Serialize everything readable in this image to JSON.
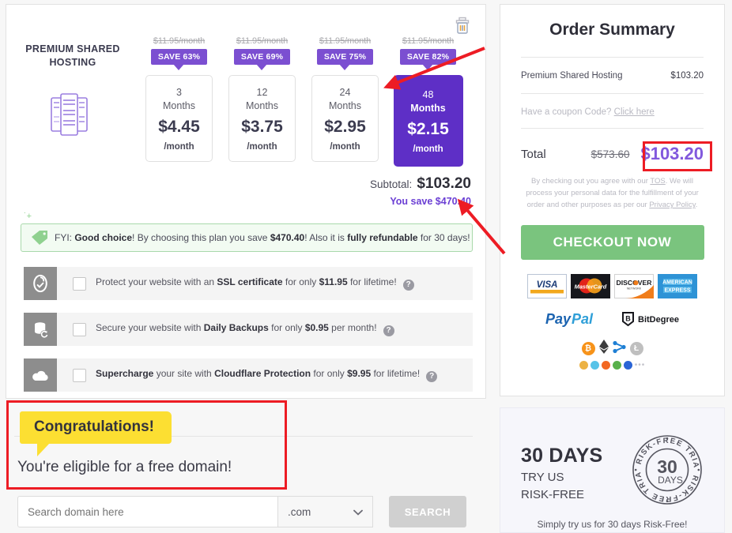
{
  "left": {
    "plan_name": "PREMIUM SHARED HOSTING",
    "plan_icon": "server-rack-icon",
    "delete_icon": "trash-icon",
    "terms": [
      {
        "old_price": "$11.95/month",
        "save_badge": "SAVE 63%",
        "months_num": "3",
        "months_label": "Months",
        "amount": "$4.45",
        "per": "/month",
        "selected": false
      },
      {
        "old_price": "$11.95/month",
        "save_badge": "SAVE 69%",
        "months_num": "12",
        "months_label": "Months",
        "amount": "$3.75",
        "per": "/month",
        "selected": false
      },
      {
        "old_price": "$11.95/month",
        "save_badge": "SAVE 75%",
        "months_num": "24",
        "months_label": "Months",
        "amount": "$2.95",
        "per": "/month",
        "selected": false
      },
      {
        "old_price": "$11.95/month",
        "save_badge": "SAVE 82%",
        "months_num": "48",
        "months_label": "Months",
        "amount": "$2.15",
        "per": "/month",
        "selected": true
      }
    ],
    "subtotal_label": "Subtotal:",
    "subtotal_value": "$103.20",
    "you_save": "You save $470.40",
    "fyi": {
      "icon": "price-tag-icon",
      "prefix": "FYI: ",
      "bold1": "Good choice",
      "mid1": "! By choosing this plan you save ",
      "bold2": "$470.40",
      "mid2": "! Also it is ",
      "bold3": "fully refundable",
      "suffix": " for 30 days!"
    },
    "addons": [
      {
        "icon": "ssl-lock-shield-icon",
        "pre": "Protect your website with an ",
        "bold1": "SSL certificate",
        "mid": " for only ",
        "bold2": "$11.95",
        "post": " for lifetime!",
        "checked": false
      },
      {
        "icon": "database-backup-icon",
        "pre": "Secure your website with ",
        "bold1": "Daily Backups",
        "mid": " for only ",
        "bold2": "$0.95",
        "post": " per month!",
        "checked": false
      },
      {
        "icon": "cloudflare-cloud-icon",
        "pre": "",
        "bold1": "Supercharge",
        "mid": " your site with ",
        "bold2": "Cloudflare Protection",
        "post": " for only $9.95 for lifetime!",
        "checked": false
      }
    ],
    "addon3_extra": {
      "bold_price": "$9.95"
    },
    "congrats_bubble": "Congratulations!",
    "eligible_text": "You're eligible for a free domain!",
    "domain_placeholder": "Search domain here",
    "domain_value": "",
    "tld_selected": ".com",
    "tld_chevron": "chevron-down-icon",
    "search_button": "SEARCH",
    "help_icon": "question-mark-icon"
  },
  "summary": {
    "title": "Order Summary",
    "item_label": "Premium Shared Hosting",
    "item_value": "$103.20",
    "coupon_text": "Have a coupon Code? ",
    "coupon_link": "Click here",
    "total_label": "Total",
    "total_old": "$573.60",
    "total_new": "$103.20",
    "legal_1": "By checking out you agree with our ",
    "legal_tos": "TOS",
    "legal_2": ". We will process your personal data for the fulfillment of your order and other purposes as per our ",
    "legal_privacy": "Privacy Policy",
    "legal_3": ".",
    "checkout_label": "CHECKOUT NOW",
    "payments": [
      "VISA",
      "MasterCard",
      "DISCOVER",
      "AMERICAN EXPRESS"
    ],
    "paypal_label": "PayPal",
    "bitdegree_label": "BitDegree",
    "crypto": [
      "bitcoin-icon",
      "ethereum-icon",
      "ripple-icon",
      "litecoin-icon"
    ],
    "crypto_more": [
      "zcash-icon",
      "dash-icon",
      "monero-icon",
      "nem-icon",
      "neo-icon",
      "more-dots-icon"
    ]
  },
  "risk": {
    "headline": "30 DAYS",
    "line2": "TRY US",
    "line3": "RISK-FREE",
    "badge_top": "RISK-FREE TRIAL",
    "badge_bottom": "RISK-FREE TRIAL",
    "badge_num": "30",
    "badge_unit": "DAYS",
    "footer": "Simply try us for 30 days Risk-Free!"
  },
  "colors": {
    "purple": "#5e2fc6",
    "badge_purple": "#7b4fd1",
    "green": "#7ac47e",
    "accent_total": "#8259dd",
    "annotation_red": "#ed1c24",
    "yellow": "#fcdf32"
  }
}
